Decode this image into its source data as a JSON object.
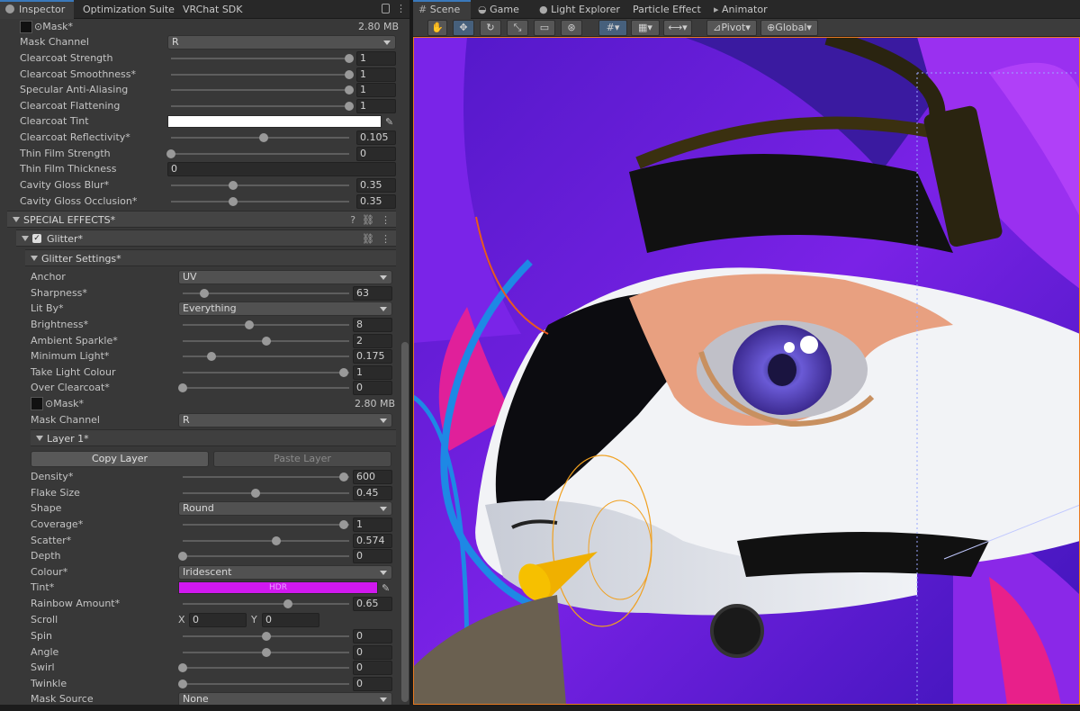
{
  "left_tabs": [
    "Inspector",
    "Optimization Suite",
    "VRChat SDK"
  ],
  "right_tabs": [
    "Scene",
    "Game",
    "Light Explorer",
    "Particle Effect",
    "Animator"
  ],
  "mask_top": {
    "label": "⊙Mask*",
    "size": "2.80 MB"
  },
  "clearcoat": {
    "mask_channel": {
      "label": "Mask Channel",
      "value": "R"
    },
    "sliders": [
      {
        "label": "Clearcoat Strength",
        "value": "1",
        "level": 1.0
      },
      {
        "label": "Clearcoat Smoothness*",
        "value": "1",
        "level": 1.0
      },
      {
        "label": "Specular Anti-Aliasing",
        "value": "1",
        "level": 1.0
      },
      {
        "label": "Clearcoat Flattening",
        "value": "1",
        "level": 1.0
      }
    ],
    "tint": {
      "label": "Clearcoat Tint",
      "color": "#ffffff"
    },
    "reflectivity": {
      "label": "Clearcoat Reflectivity*",
      "value": "0.105",
      "level": 0.5
    },
    "thin_film_strength": {
      "label": "Thin Film Strength",
      "value": "0",
      "level": 0.0
    },
    "thin_film_thickness": {
      "label": "Thin Film Thickness",
      "value": "0"
    },
    "gloss_blur": {
      "label": "Cavity Gloss Blur*",
      "value": "0.35",
      "level": 0.35
    },
    "gloss_occlusion": {
      "label": "Cavity Gloss Occlusion*",
      "value": "0.35",
      "level": 0.35
    }
  },
  "special_effects": {
    "title": "SPECIAL EFFECTS*"
  },
  "glitter": {
    "title": "Glitter*",
    "checked": true
  },
  "glitter_settings": {
    "title": "Glitter Settings*",
    "anchor": {
      "label": "Anchor",
      "value": "UV"
    },
    "sharpness": {
      "label": "Sharpness*",
      "value": "63",
      "level": 0.13
    },
    "lit_by": {
      "label": "Lit By*",
      "value": "Everything"
    },
    "brightness": {
      "label": "Brightness*",
      "value": "8",
      "level": 0.4
    },
    "ambient": {
      "label": "Ambient Sparkle*",
      "value": "2",
      "level": 0.5
    },
    "min_light": {
      "label": "Minimum Light*",
      "value": "0.175",
      "level": 0.175
    },
    "take_light": {
      "label": "Take Light Colour",
      "value": "1",
      "level": 1.0
    },
    "over_clearcoat": {
      "label": "Over Clearcoat*",
      "value": "0",
      "level": 0.0
    },
    "mask": {
      "label": "⊙Mask*",
      "size": "2.80 MB"
    },
    "mask_channel": {
      "label": "Mask Channel",
      "value": "R"
    }
  },
  "layer1": {
    "title": "Layer 1*",
    "copy": "Copy Layer",
    "paste": "Paste Layer",
    "density": {
      "label": "Density*",
      "value": "600",
      "level": 1.0
    },
    "flake_size": {
      "label": "Flake Size",
      "value": "0.45",
      "level": 0.45
    },
    "shape": {
      "label": "Shape",
      "value": "Round"
    },
    "coverage": {
      "label": "Coverage*",
      "value": "1",
      "level": 1.0
    },
    "scatter": {
      "label": "Scatter*",
      "value": "0.574",
      "level": 0.574
    },
    "depth": {
      "label": "Depth",
      "value": "0",
      "level": 0.0
    },
    "colour": {
      "label": "Colour*",
      "value": "Iridescent"
    },
    "tint": {
      "label": "Tint*",
      "color": "#d118f0",
      "hdr": "HDR"
    },
    "rainbow": {
      "label": "Rainbow Amount*",
      "value": "0.65",
      "level": 0.65
    },
    "scroll": {
      "label": "Scroll",
      "x_label": "X",
      "x": "0",
      "y_label": "Y",
      "y": "0"
    },
    "spin": {
      "label": "Spin",
      "value": "0",
      "level": 0.5
    },
    "angle": {
      "label": "Angle",
      "value": "0",
      "level": 0.5
    },
    "swirl": {
      "label": "Swirl",
      "value": "0",
      "level": 0.0
    },
    "twinkle": {
      "label": "Twinkle",
      "value": "0",
      "level": 0.0
    },
    "mask_source": {
      "label": "Mask Source",
      "value": "None"
    }
  },
  "toolbar": {
    "pivot": "Pivot",
    "global": "Global"
  },
  "colors": {
    "accent": "#3a79bb",
    "scene_purple": "#6a1ed8",
    "outline": "#1e88e5",
    "goggle": "#2a2410",
    "gold": "#c8a040"
  }
}
